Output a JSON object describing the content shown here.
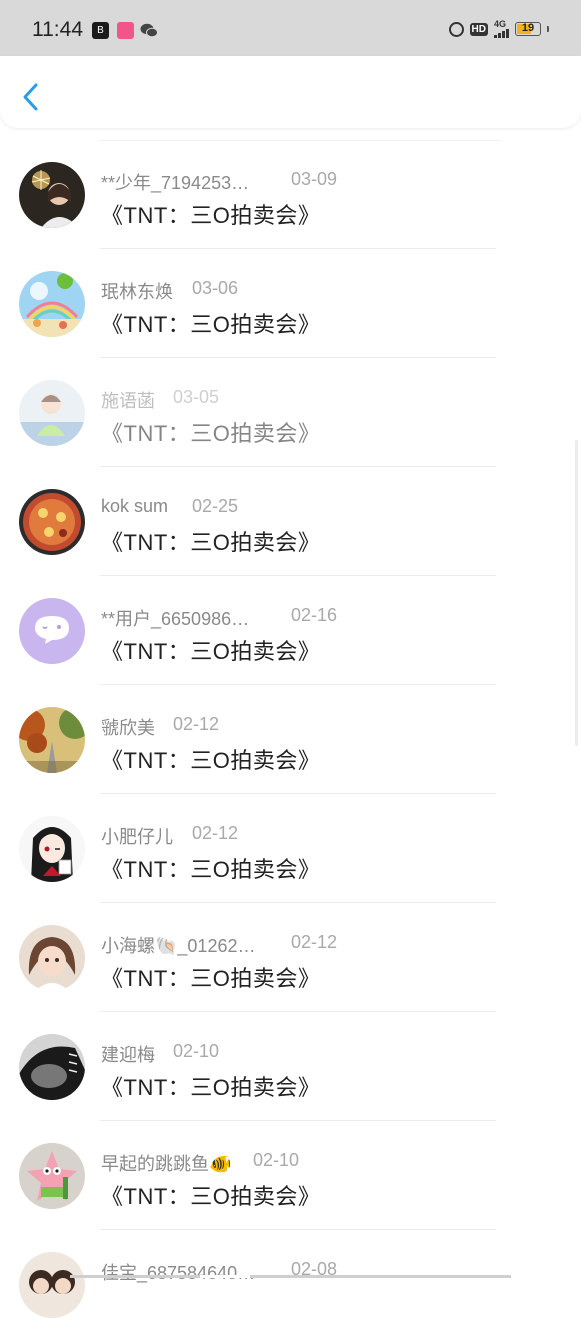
{
  "status_bar": {
    "time": "11:44",
    "network": "4G",
    "battery": "19"
  },
  "header": {
    "back_icon": "chevron-left-icon",
    "accent_color": "#2a9dea"
  },
  "list": {
    "items": [
      {
        "name": "**少年_7194253…",
        "date": "03-09",
        "title": "《TNT：三O拍卖会》",
        "avatar": "sparkler-girl"
      },
      {
        "name": "珉林东焕",
        "date": "03-06",
        "title": "《TNT：三O拍卖会》",
        "avatar": "rainbow-sky"
      },
      {
        "name": "施语菡",
        "date": "03-05",
        "title": "《TNT：三O拍卖会》",
        "avatar": "child-photo",
        "faded": true
      },
      {
        "name": "kok sum",
        "date": "02-25",
        "title": "《TNT：三O拍卖会》",
        "avatar": "pizza"
      },
      {
        "name": "**用户_6650986…",
        "date": "02-16",
        "title": "《TNT：三O拍卖会》",
        "avatar": "default-purple"
      },
      {
        "name": "虢欣美",
        "date": "02-12",
        "title": "《TNT：三O拍卖会》",
        "avatar": "autumn-road"
      },
      {
        "name": "小肥仔儿",
        "date": "02-12",
        "title": "《TNT：三O拍卖会》",
        "avatar": "anime-girl"
      },
      {
        "name": "小海螺🐚_01262…",
        "date": "02-12",
        "title": "《TNT：三O拍卖会》",
        "avatar": "baby-girl"
      },
      {
        "name": "建迎梅",
        "date": "02-10",
        "title": "《TNT：三O拍卖会》",
        "avatar": "bw-portrait"
      },
      {
        "name": "早起的跳跳鱼🐠",
        "date": "02-10",
        "title": "《TNT：三O拍卖会》",
        "avatar": "patrick-star"
      },
      {
        "name": "佳宝_687584640…",
        "date": "02-08",
        "title": "",
        "avatar": "two-girls"
      }
    ]
  }
}
